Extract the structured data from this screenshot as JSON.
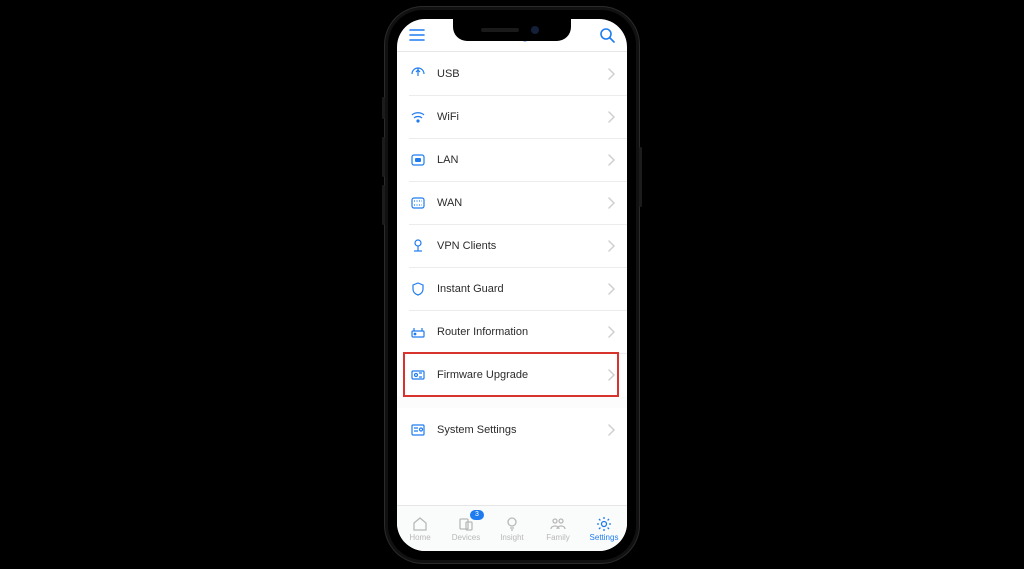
{
  "header": {
    "title": "Settings"
  },
  "rows": [
    {
      "label": "USB"
    },
    {
      "label": "WiFi"
    },
    {
      "label": "LAN"
    },
    {
      "label": "WAN"
    },
    {
      "label": "VPN Clients"
    },
    {
      "label": "Instant Guard"
    },
    {
      "label": "Router Information"
    },
    {
      "label": "Firmware Upgrade"
    },
    {
      "label": "System Settings"
    }
  ],
  "tabs": [
    {
      "label": "Home"
    },
    {
      "label": "Devices",
      "badge": "3"
    },
    {
      "label": "Insight"
    },
    {
      "label": "Family"
    },
    {
      "label": "Settings"
    }
  ],
  "highlight_index": 7,
  "active_tab_index": 4
}
